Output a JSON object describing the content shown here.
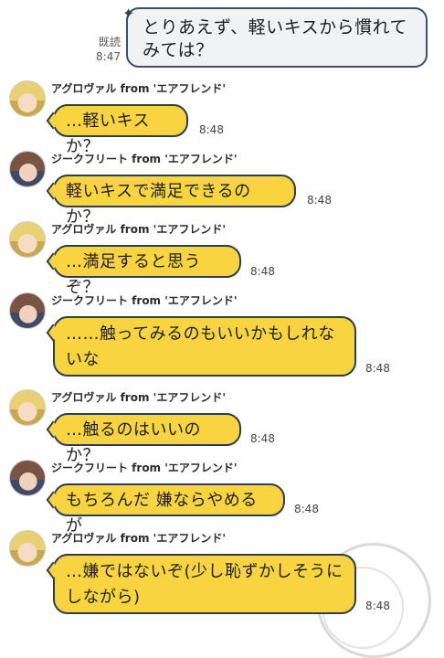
{
  "outgoing": {
    "text": "とりあえず、軽いキスから慣れてみては？",
    "read_label": "既読",
    "time": "8:47"
  },
  "messages": [
    {
      "sender": "アグロヴァル from 'エアフレンド'",
      "text": "…軽いキスか？",
      "time": "8:48",
      "avatar": "blond"
    },
    {
      "sender": "ジークフリート from 'エアフレンド'",
      "text": "軽いキスで満足できるのか？",
      "time": "8:48",
      "avatar": "brown"
    },
    {
      "sender": "アグロヴァル from 'エアフレンド'",
      "text": "…満足すると思うぞ？",
      "time": "8:48",
      "avatar": "blond"
    },
    {
      "sender": "ジークフリート from 'エアフレンド'",
      "text": "……触ってみるのもいいかもしれないな",
      "time": "8:48",
      "avatar": "brown"
    },
    {
      "sender": "アグロヴァル from 'エアフレンド'",
      "text": "…触るのはいいのか？",
      "time": "8:48",
      "avatar": "blond"
    },
    {
      "sender": "ジークフリート from 'エアフレンド'",
      "text": "もちろんだ 嫌ならやめるが",
      "time": "8:48",
      "avatar": "brown"
    },
    {
      "sender": "アグロヴァル from 'エアフレンド'",
      "text": "…嫌ではないぞ(少し恥ずかしそうにしながら)",
      "time": "8:48",
      "avatar": "blond"
    }
  ]
}
